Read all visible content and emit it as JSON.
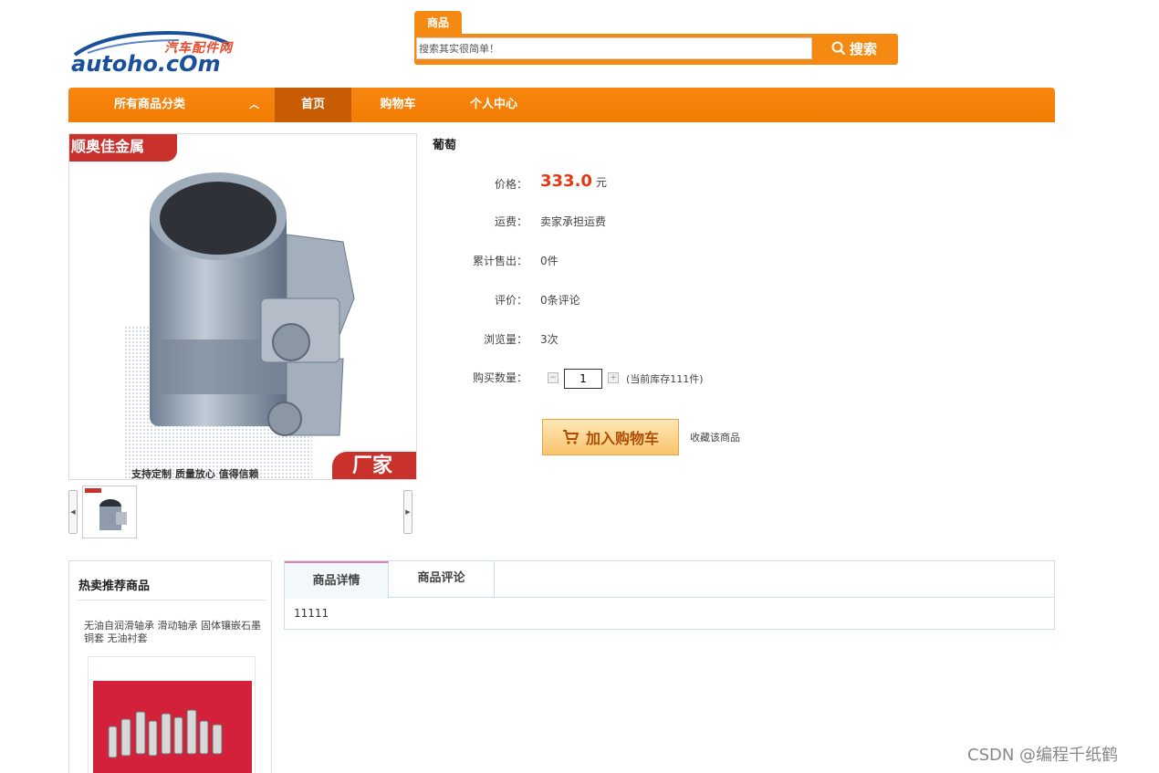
{
  "logo": {
    "cn": "汽车配件网",
    "en": "autoho.cOm"
  },
  "search": {
    "tab_label": "商品",
    "value": "搜索其实很简单！",
    "button_label": "搜索"
  },
  "nav": {
    "category_label": "所有商品分类",
    "items": [
      {
        "label": "首页",
        "active": true
      },
      {
        "label": "购物车"
      },
      {
        "label": "个人中心"
      }
    ]
  },
  "gallery": {
    "badge_top": "顺奥佳金属",
    "badge_bottom": "厂家",
    "caption": "支持定制 质量放心 值得信赖"
  },
  "product": {
    "title": "葡萄",
    "price_label": "价格：",
    "price": "333.0",
    "price_unit": "元",
    "shipping_label": "运费：",
    "shipping": "卖家承担运费",
    "sold_label": "累计售出：",
    "sold": "0件",
    "rating_label": "评价：",
    "rating": "0条评论",
    "views_label": "浏览量：",
    "views": "3次",
    "qty_label": "购买数量：",
    "qty": "1",
    "stock": "(当前库存111件)",
    "cart_button": "加入购物车",
    "favorite_link": "收藏该商品"
  },
  "hot": {
    "title": "热卖推荐商品",
    "item_desc": "无油自润滑轴承 滑动轴承 固体镶嵌石墨铜套 无油衬套"
  },
  "tabs": {
    "items": [
      "商品详情",
      "商品评论"
    ],
    "content": "11111"
  },
  "watermark": "CSDN @编程千纸鹤",
  "colors": {
    "accent": "#f58a13",
    "nav_active": "#c75c05",
    "price": "#e4390e"
  }
}
